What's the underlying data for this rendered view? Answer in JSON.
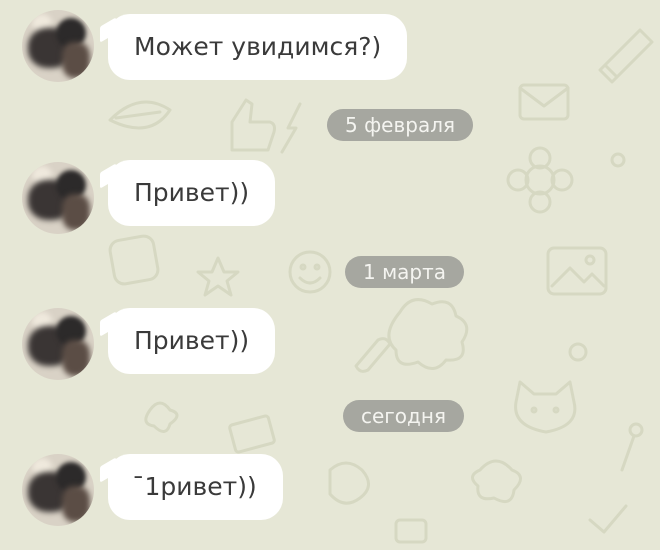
{
  "colors": {
    "background": "#e6e7d6",
    "bubble": "#ffffff",
    "date_pill": "#a6a7a0",
    "date_text": "#f4f4f0",
    "message_text": "#3a3a3a"
  },
  "chat": {
    "items": [
      {
        "type": "message",
        "text": "Может увидимся?)",
        "avatar": "contact-avatar"
      },
      {
        "type": "date",
        "label": "5 февраля"
      },
      {
        "type": "message",
        "text": "Привет))",
        "avatar": "contact-avatar"
      },
      {
        "type": "date",
        "label": "1 марта"
      },
      {
        "type": "message",
        "text": "Привет))",
        "avatar": "contact-avatar"
      },
      {
        "type": "date",
        "label": "сегодня"
      },
      {
        "type": "message",
        "text": "ˉ1ривет))",
        "avatar": "contact-avatar"
      }
    ]
  }
}
